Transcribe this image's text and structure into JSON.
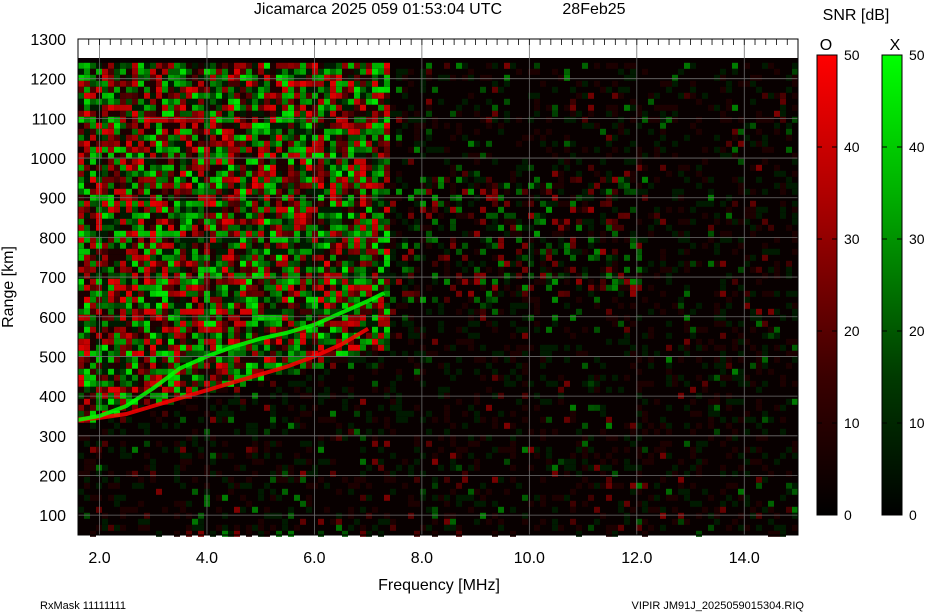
{
  "header": {
    "title": "Jicamarca 2025 059 01:53:04 UTC",
    "date": "28Feb25"
  },
  "footer": {
    "left": "RxMask 11111111",
    "right": "VIPIR  JM91J_2025059015304.RIQ"
  },
  "colorbar": {
    "title": "SNR [dB]",
    "o_label": "O",
    "x_label": "X",
    "ticks": [
      "0",
      "10",
      "20",
      "30",
      "40",
      "50"
    ],
    "o_color": "#ff0000",
    "x_color": "#00ff00"
  },
  "chart_data": {
    "type": "heatmap",
    "title": "Jicamarca 2025 059 01:53:04 UTC",
    "xlabel": "Frequency [MHz]",
    "ylabel": "Range [km]",
    "xlim": [
      1.6,
      15.0
    ],
    "ylim": [
      50,
      1300
    ],
    "xticks": [
      "2.0",
      "4.0",
      "6.0",
      "8.0",
      "10.0",
      "12.0",
      "14.0"
    ],
    "yticks": [
      "100",
      "200",
      "300",
      "400",
      "500",
      "600",
      "700",
      "800",
      "900",
      "1000",
      "1100",
      "1200",
      "1300"
    ],
    "grid": true,
    "colorscale": "SNR [dB], 0 to 50; O-mode red, X-mode green",
    "data_range_top_km": 1240,
    "traces": [
      {
        "name": "O",
        "x": [
          1.6,
          2.0,
          2.5,
          3.0,
          3.5,
          4.0,
          4.5,
          5.0,
          5.5,
          6.0,
          6.5,
          7.0
        ],
        "y": [
          340,
          345,
          355,
          375,
          395,
          415,
          435,
          455,
          475,
          500,
          530,
          570
        ]
      },
      {
        "name": "X",
        "x": [
          1.6,
          2.0,
          2.5,
          3.0,
          3.5,
          4.0,
          4.5,
          5.0,
          5.5,
          6.0,
          6.5,
          7.0,
          7.3
        ],
        "y": [
          340,
          350,
          375,
          420,
          470,
          500,
          525,
          545,
          560,
          580,
          610,
          640,
          660
        ]
      }
    ]
  }
}
